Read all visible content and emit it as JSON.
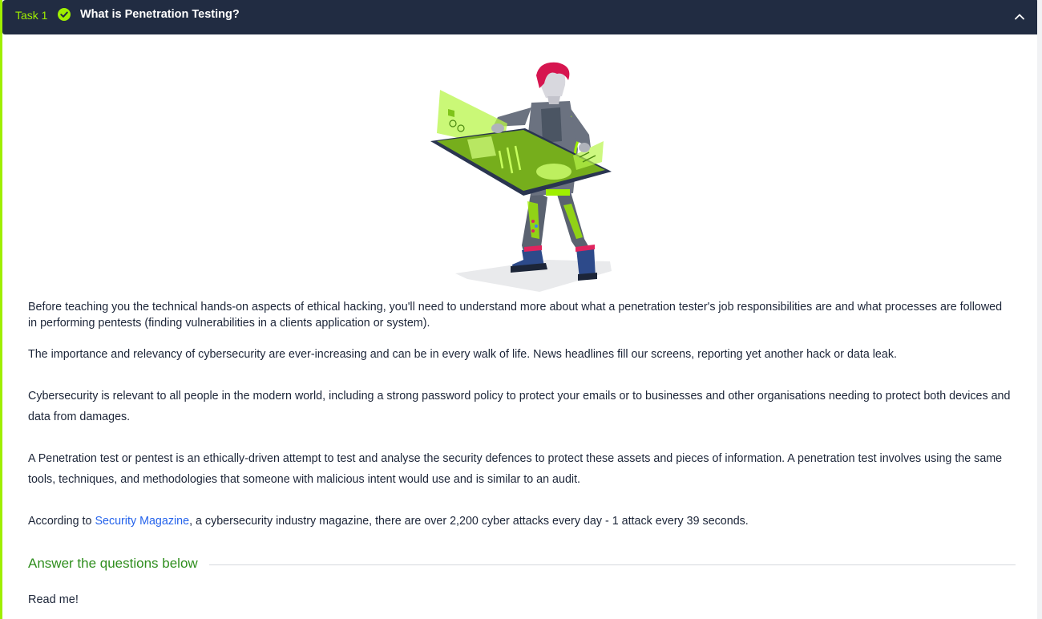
{
  "task": {
    "number_label": "Task 1",
    "title": "What is Penetration Testing?",
    "completed": true,
    "accent_color": "#9fef00",
    "header_bg": "#212c42"
  },
  "icons": {
    "status": "check-circle-icon",
    "collapse": "chevron-up-icon"
  },
  "content": {
    "hero_image": "penetration-tester-illustration",
    "paragraph_1": "Before teaching you the technical hands-on aspects of ethical hacking, you'll need to understand more about what a penetration tester's job responsibilities are and what processes are followed in performing pentests (finding vulnerabilities in a clients application or system).",
    "paragraph_2": "The importance and relevancy of cybersecurity are ever-increasing and can be in every walk of life. News headlines fill our screens, reporting yet another hack or data leak.",
    "paragraph_3": "Cybersecurity is relevant to all people in the modern world, including a strong password policy to protect your emails or to businesses and other organisations needing to protect both devices and data from damages.",
    "paragraph_4": "A Penetration test or pentest is an ethically-driven attempt to test and analyse the security defences to protect these assets and pieces of information. A penetration test involves using the same tools, techniques, and methodologies that someone with malicious intent would use and is similar to an audit.",
    "paragraph_5": {
      "prefix": "According to ",
      "link_text": "Security Magazine",
      "suffix": ", a cybersecurity industry magazine, there are over 2,200 cyber attacks every day - 1 attack every 39 seconds."
    }
  },
  "questions": {
    "heading": "Answer the questions below",
    "items": [
      {
        "text": "Read me!"
      }
    ]
  }
}
